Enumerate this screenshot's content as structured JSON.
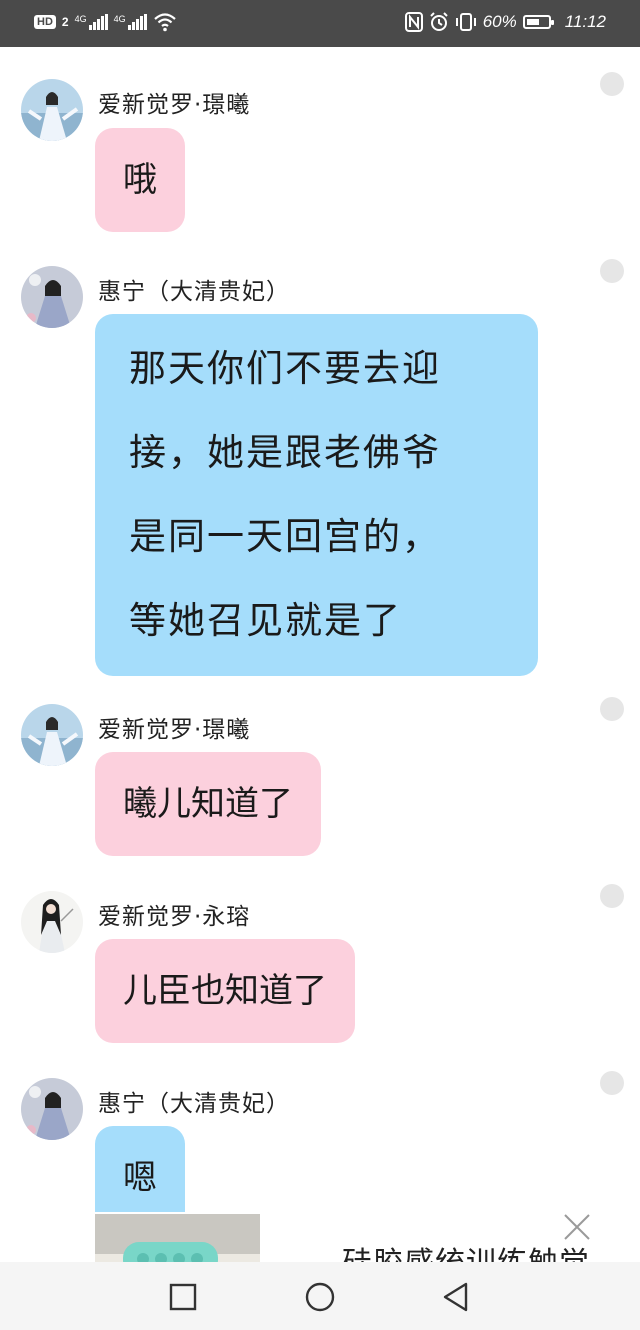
{
  "status_bar": {
    "hd_label": "HD",
    "sim1": "2",
    "net1": "4G",
    "net2": "4G",
    "battery_text": "60%",
    "battery_level": 0.6,
    "time": "11:12",
    "icons": [
      "hd-icon",
      "signal-icon",
      "wifi-icon",
      "nfc-icon",
      "alarm-icon",
      "vibrate-icon",
      "battery-icon"
    ]
  },
  "messages": [
    {
      "sender": "爱新觉罗·璟曦",
      "text": "哦",
      "color": "#fcd0dd",
      "avatar": "avatar-girl-blue-dress"
    },
    {
      "sender": "惠宁（大清贵妃）",
      "lines": [
        "那天你们不要去迎",
        "接，她是跟老佛爷",
        "是同一天回宫的，",
        "等她召见就是了"
      ],
      "color": "#a5ddfb",
      "avatar": "avatar-girl-hanfu"
    },
    {
      "sender": "爱新觉罗·璟曦",
      "text": "曦儿知道了",
      "color": "#fcd0dd",
      "avatar": "avatar-girl-blue-dress"
    },
    {
      "sender": "爱新觉罗·永瑢",
      "text": "儿臣也知道了",
      "color": "#fcd0dd",
      "avatar": "avatar-ink-figure"
    },
    {
      "sender": "惠宁（大清贵妃）",
      "text": "嗯",
      "color": "#a5ddfb",
      "avatar": "avatar-girl-hanfu"
    }
  ],
  "ad": {
    "title": "硅胶感统训练触觉",
    "image": "silicone-brush-product-image",
    "close_icon": "close-icon"
  },
  "nav_bar": {
    "buttons": [
      "recent-apps-button",
      "home-button",
      "back-button"
    ]
  }
}
